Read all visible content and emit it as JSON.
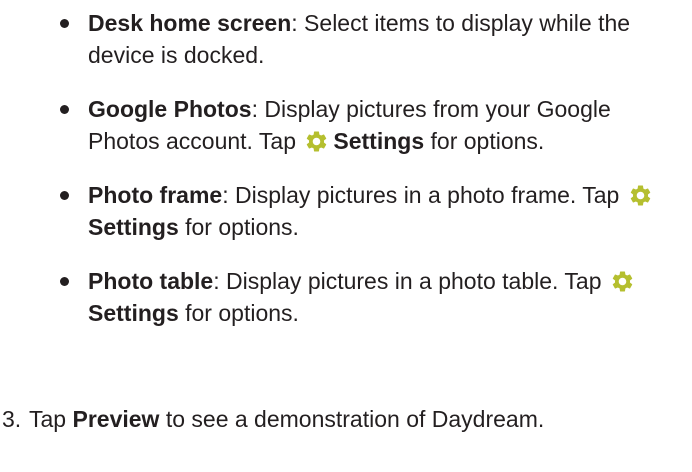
{
  "bullets": [
    {
      "term": "Desk home screen",
      "text_a": ": Select items to display while the device is docked."
    },
    {
      "term": "Google Photos",
      "text_a": ": Display pictures from your Google Photos account. Tap ",
      "icon": "settings-gear-icon",
      "settings": "Settings",
      "text_b": " for options."
    },
    {
      "term": "Photo frame",
      "text_a": ": Display pictures in a photo frame. Tap ",
      "icon": "settings-gear-icon",
      "settings": "Settings",
      "text_b": " for options."
    },
    {
      "term": "Photo table",
      "text_a": ": Display pictures in a photo table. Tap ",
      "icon": "settings-gear-icon",
      "settings": "Settings",
      "text_b": " for options."
    }
  ],
  "step": {
    "number": "3.",
    "text_a": "Tap ",
    "preview": "Preview",
    "text_b": " to see a demonstration of Daydream."
  },
  "colors": {
    "text": "#231f20",
    "gear": "#b5bf2f"
  }
}
